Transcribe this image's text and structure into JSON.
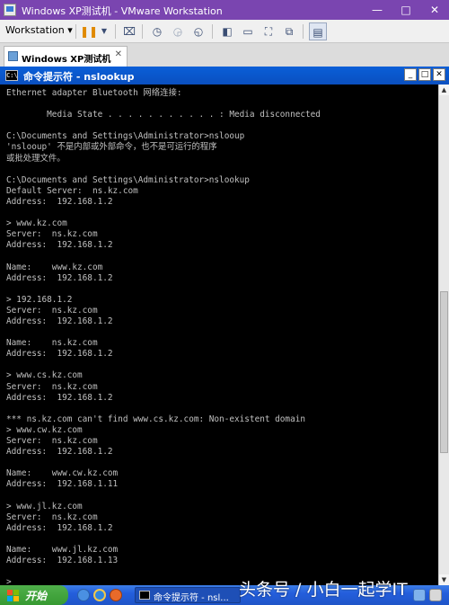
{
  "host": {
    "title": "Windows XP测试机 - VMware Workstation",
    "minimize_label": "—",
    "maximize_label": "□",
    "close_label": "✕"
  },
  "toolbar": {
    "menu_label": "Workstation ▾",
    "icons": [
      "pause-icon",
      "dropdown-icon",
      "send-keys-icon",
      "snapshot-icon",
      "revert-snapshot-icon",
      "snapshot-manager-icon",
      "sidebar-icon",
      "console-view-icon",
      "fullscreen-icon",
      "unity-icon",
      "library-icon"
    ]
  },
  "vm_tab": {
    "label": "Windows XP测试机",
    "close_label": "✕"
  },
  "cmd": {
    "title": "命令提示符 - nslookup",
    "icon_label": "C:\\",
    "min_label": "_",
    "max_label": "□",
    "close_label": "✕",
    "lines": [
      "Ethernet adapter Bluetooth 网络连接:",
      "",
      "        Media State . . . . . . . . . . . : Media disconnected",
      "",
      "C:\\Documents and Settings\\Administrator>nslooup",
      "'nslooup' 不是内部或外部命令，也不是可运行的程序",
      "或批处理文件。",
      "",
      "C:\\Documents and Settings\\Administrator>nslookup",
      "Default Server:  ns.kz.com",
      "Address:  192.168.1.2",
      "",
      "> www.kz.com",
      "Server:  ns.kz.com",
      "Address:  192.168.1.2",
      "",
      "Name:    www.kz.com",
      "Address:  192.168.1.2",
      "",
      "> 192.168.1.2",
      "Server:  ns.kz.com",
      "Address:  192.168.1.2",
      "",
      "Name:    ns.kz.com",
      "Address:  192.168.1.2",
      "",
      "> www.cs.kz.com",
      "Server:  ns.kz.com",
      "Address:  192.168.1.2",
      "",
      "*** ns.kz.com can't find www.cs.kz.com: Non-existent domain",
      "> www.cw.kz.com",
      "Server:  ns.kz.com",
      "Address:  192.168.1.2",
      "",
      "Name:    www.cw.kz.com",
      "Address:  192.168.1.11",
      "",
      "> www.jl.kz.com",
      "Server:  ns.kz.com",
      "Address:  192.168.1.2",
      "",
      "Name:    www.jl.kz.com",
      "Address:  192.168.1.13",
      "",
      ">"
    ]
  },
  "taskbar": {
    "start_label": "开始",
    "task_label": "命令提示符 - nsl...",
    "quicklaunch_icons": [
      "show-desktop-icon",
      "ie-icon",
      "media-player-icon"
    ],
    "tray_icons": [
      "network-icon",
      "volume-icon"
    ]
  },
  "watermark": "头条号 / 小白一起学IT",
  "colors": {
    "console_bg": "#000000",
    "console_text": "#c0c0c0",
    "cmd_title_bg": "#0a5fd8",
    "host_title_bg": "#7a45b0",
    "taskbar_bg": "#245edc",
    "start_bg": "#379a32"
  }
}
